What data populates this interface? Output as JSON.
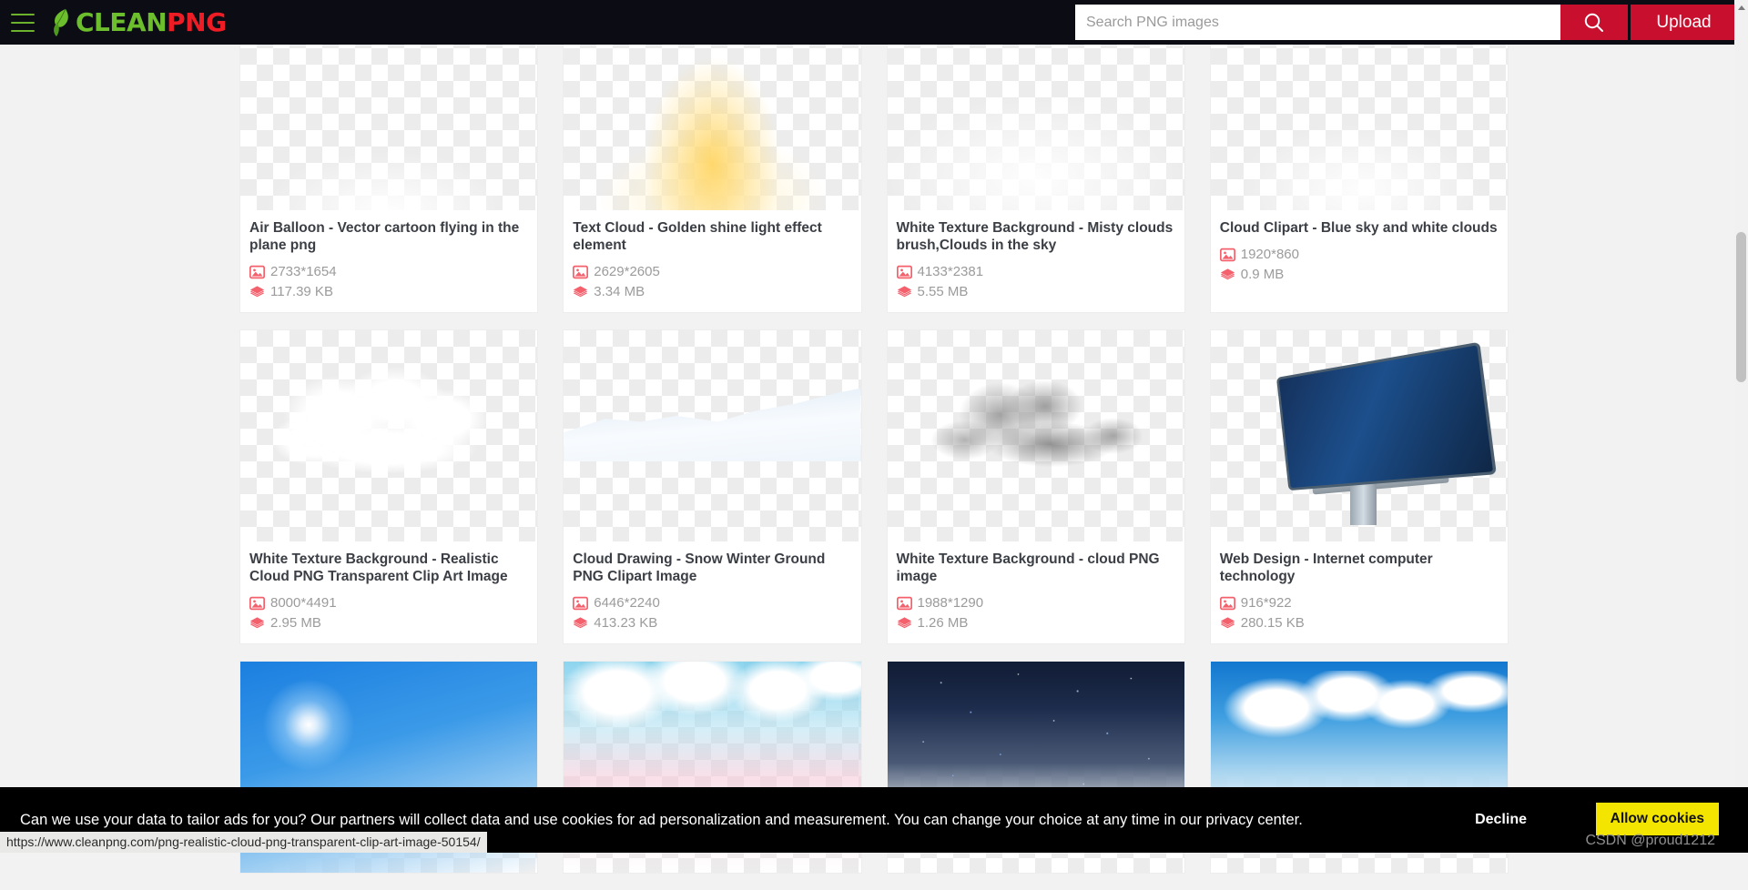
{
  "header": {
    "logo_clean": "CLEAN",
    "logo_png": "PNG",
    "search_placeholder": "Search PNG images",
    "search_value": "",
    "upload_label": "Upload"
  },
  "grid": {
    "rows": [
      {
        "cards": [
          {
            "title": "Air Balloon - Vector cartoon flying in the plane png",
            "dimensions": "2733*1654",
            "filesize": "117.39 KB",
            "thumb": "t-balloon"
          },
          {
            "title": "Text Cloud - Golden shine light effect element",
            "dimensions": "2629*2605",
            "filesize": "3.34 MB",
            "thumb": "t-textcloud"
          },
          {
            "title": "White Texture Background - Misty clouds brush,Clouds in the sky",
            "dimensions": "4133*2381",
            "filesize": "5.55 MB",
            "thumb": "t-misty"
          },
          {
            "title": "Cloud Clipart - Blue sky and white clouds",
            "dimensions": "1920*860",
            "filesize": "0.9 MB",
            "thumb": "t-blueclip"
          }
        ]
      },
      {
        "cards": [
          {
            "title": "White Texture Background - Realistic Cloud PNG Transparent Clip Art Image",
            "dimensions": "8000*4491",
            "filesize": "2.95 MB",
            "thumb": "t-realistic"
          },
          {
            "title": "Cloud Drawing - Snow Winter Ground PNG Clipart Image",
            "dimensions": "6446*2240",
            "filesize": "413.23 KB",
            "thumb": "t-snow"
          },
          {
            "title": "White Texture Background - cloud PNG image",
            "dimensions": "1988*1290",
            "filesize": "1.26 MB",
            "thumb": "t-greycloud"
          },
          {
            "title": "Web Design - Internet computer technology",
            "dimensions": "916*922",
            "filesize": "280.15 KB",
            "thumb": "t-webdesign"
          }
        ]
      },
      {
        "cards": [
          {
            "title": "",
            "dimensions": "",
            "filesize": "",
            "thumb": "t-sun"
          },
          {
            "title": "",
            "dimensions": "",
            "filesize": "",
            "thumb": "t-pink"
          },
          {
            "title": "",
            "dimensions": "",
            "filesize": "",
            "thumb": "t-night"
          },
          {
            "title": "",
            "dimensions": "",
            "filesize": "",
            "thumb": "t-bluesky"
          }
        ]
      }
    ]
  },
  "cookie": {
    "message": "Can we use your data to tailor ads for you? Our partners will collect data and use cookies for ad personalization and measurement. You can change your choice at any time in our privacy center.",
    "decline_label": "Decline",
    "allow_label": "Allow cookies"
  },
  "watermark": "CSDN @proud1212",
  "statusbar": {
    "url": "https://www.cleanpng.com/png-realistic-cloud-png-transparent-clip-art-image-50154/"
  },
  "colors": {
    "brand_red": "#c8102e",
    "brand_green": "#6cbe2c",
    "header_bg": "#0c0d14",
    "cookie_accent": "#f3e500"
  }
}
